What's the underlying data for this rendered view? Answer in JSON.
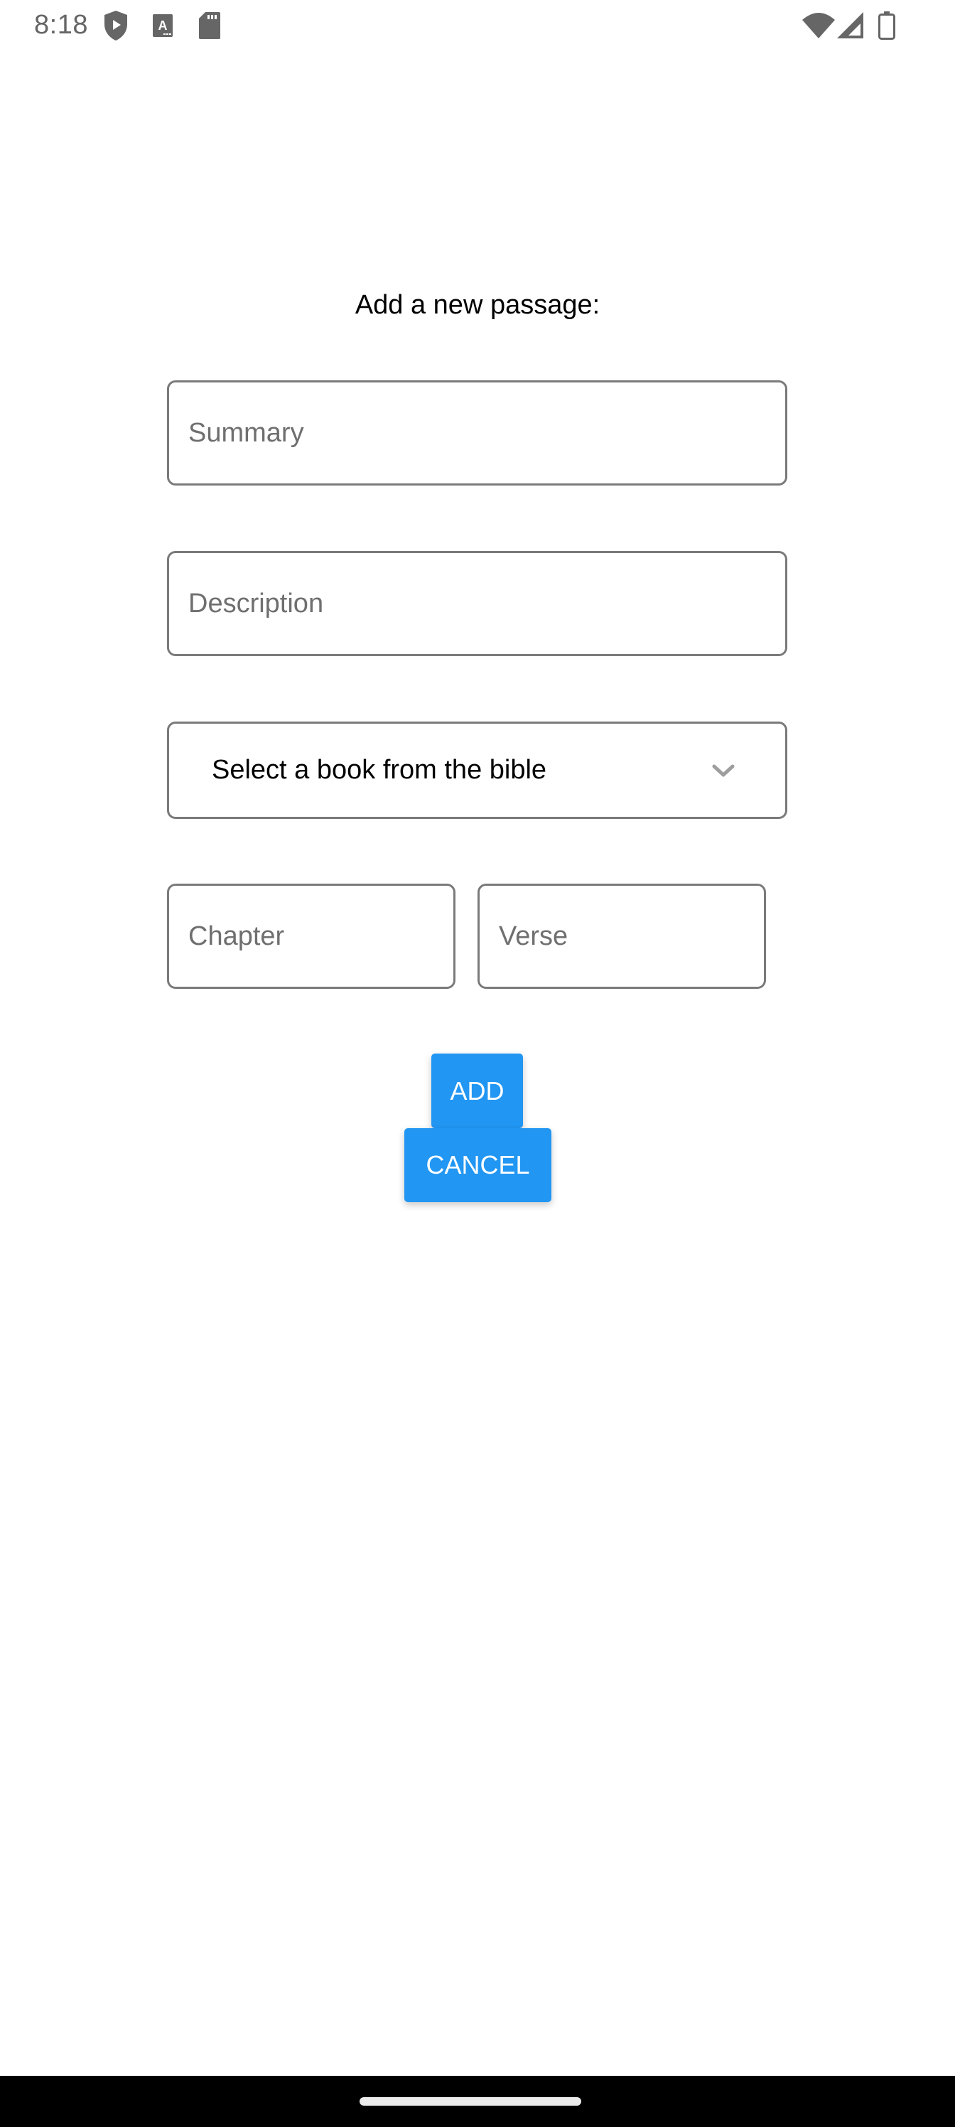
{
  "status_bar": {
    "time": "8:18",
    "left_icons": [
      "play-protect-shield-icon",
      "keyboard-a-icon",
      "sd-card-icon"
    ],
    "right_icons": [
      "wifi-icon",
      "cellular-signal-icon",
      "battery-icon"
    ]
  },
  "form": {
    "title": "Add a new passage:",
    "summary_placeholder": "Summary",
    "description_placeholder": "Description",
    "book_select": {
      "selected_label": "Select a book from the bible"
    },
    "chapter_placeholder": "Chapter",
    "verse_placeholder": "Verse"
  },
  "actions": {
    "add_label": "ADD",
    "cancel_label": "CANCEL"
  },
  "colors": {
    "accent": "#2196f3",
    "field_border": "#7a7a7a",
    "placeholder": "#6f6f6f"
  }
}
